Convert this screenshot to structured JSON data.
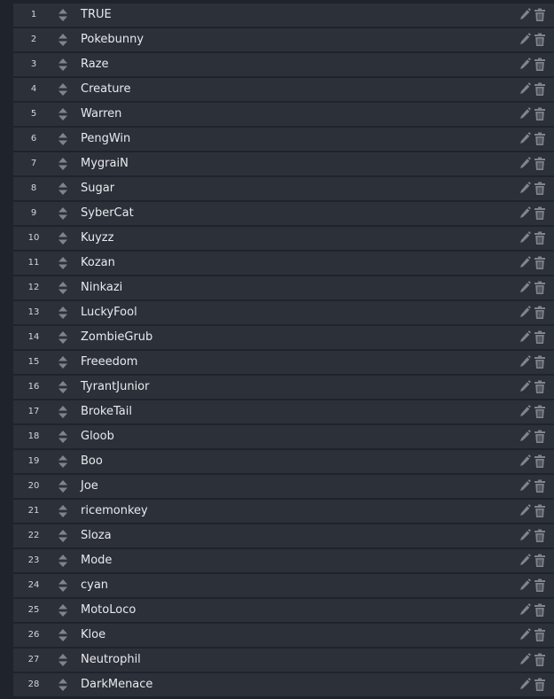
{
  "colors": {
    "background": "#1f232b",
    "row": "#2c3039",
    "text": "#e8eaee",
    "icon": "#7f848d"
  },
  "icons": {
    "sort": "sort-arrows-icon",
    "edit": "pencil-icon",
    "delete": "trash-icon"
  },
  "rows": [
    {
      "num": "1",
      "name": "TRUE"
    },
    {
      "num": "2",
      "name": "Pokebunny"
    },
    {
      "num": "3",
      "name": "Raze"
    },
    {
      "num": "4",
      "name": "Creature"
    },
    {
      "num": "5",
      "name": "Warren"
    },
    {
      "num": "6",
      "name": "PengWin"
    },
    {
      "num": "7",
      "name": "MygraiN"
    },
    {
      "num": "8",
      "name": "Sugar"
    },
    {
      "num": "9",
      "name": "SyberCat"
    },
    {
      "num": "10",
      "name": "Kuyzz"
    },
    {
      "num": "11",
      "name": "Kozan"
    },
    {
      "num": "12",
      "name": "Ninkazi"
    },
    {
      "num": "13",
      "name": "LuckyFool"
    },
    {
      "num": "14",
      "name": "ZombieGrub"
    },
    {
      "num": "15",
      "name": "Freeedom"
    },
    {
      "num": "16",
      "name": "TyrantJunior"
    },
    {
      "num": "17",
      "name": "BrokeTail"
    },
    {
      "num": "18",
      "name": "Gloob"
    },
    {
      "num": "19",
      "name": "Boo"
    },
    {
      "num": "20",
      "name": "Joe"
    },
    {
      "num": "21",
      "name": "ricemonkey"
    },
    {
      "num": "22",
      "name": "Sloza"
    },
    {
      "num": "23",
      "name": "Mode"
    },
    {
      "num": "24",
      "name": "cyan"
    },
    {
      "num": "25",
      "name": "MotoLoco"
    },
    {
      "num": "26",
      "name": "Kloe"
    },
    {
      "num": "27",
      "name": "Neutrophil"
    },
    {
      "num": "28",
      "name": "DarkMenace"
    }
  ]
}
